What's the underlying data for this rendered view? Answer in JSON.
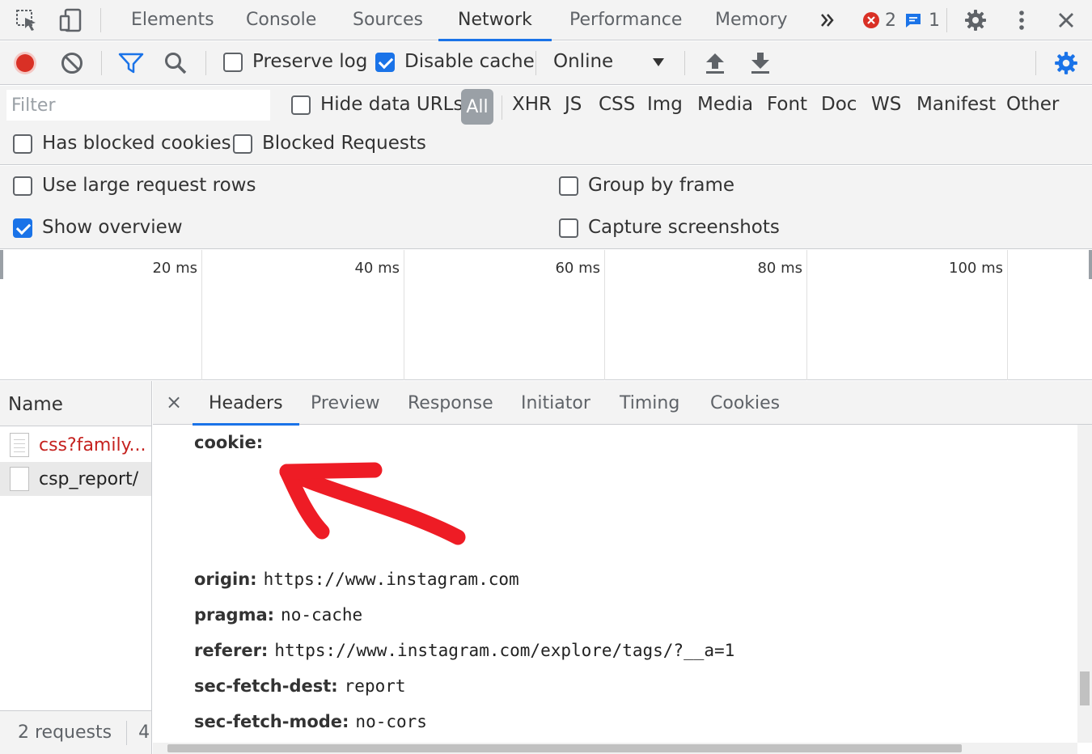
{
  "main_tabs": [
    "Elements",
    "Console",
    "Sources",
    "Network",
    "Performance",
    "Memory"
  ],
  "badges": {
    "errors": "2",
    "messages": "1"
  },
  "toolbar": {
    "preserve_log": "Preserve log",
    "disable_cache": "Disable cache",
    "throttling": "Online"
  },
  "filter": {
    "placeholder": "Filter",
    "hide_data_urls": "Hide data URLs",
    "all": "All",
    "types": [
      "XHR",
      "JS",
      "CSS",
      "Img",
      "Media",
      "Font",
      "Doc",
      "WS",
      "Manifest",
      "Other"
    ],
    "has_blocked_cookies": "Has blocked cookies",
    "blocked_requests": "Blocked Requests"
  },
  "settings": {
    "large_rows": "Use large request rows",
    "group_by_frame": "Group by frame",
    "show_overview": "Show overview",
    "capture_screenshots": "Capture screenshots"
  },
  "overview": {
    "ticks": [
      "20 ms",
      "40 ms",
      "60 ms",
      "80 ms",
      "100 ms"
    ]
  },
  "requests": {
    "header": "Name",
    "rows": [
      "css?family...",
      "csp_report/"
    ],
    "status": "2 requests",
    "status_extra": "4"
  },
  "detail": {
    "close": "×",
    "tabs": [
      "Headers",
      "Preview",
      "Response",
      "Initiator",
      "Timing",
      "Cookies"
    ],
    "headers": [
      {
        "key": "cookie:",
        "value": ""
      },
      {
        "key": "origin:",
        "value": "https://www.instagram.com"
      },
      {
        "key": "pragma:",
        "value": "no-cache"
      },
      {
        "key": "referer:",
        "value": "https://www.instagram.com/explore/tags/?__a=1"
      },
      {
        "key": "sec-fetch-dest:",
        "value": "report"
      },
      {
        "key": "sec-fetch-mode:",
        "value": "no-cors"
      }
    ]
  },
  "colors": {
    "accent": "#1a73e8",
    "record": "#d93025",
    "annotation": "#ee1c25",
    "error_text": "#c5221f"
  }
}
